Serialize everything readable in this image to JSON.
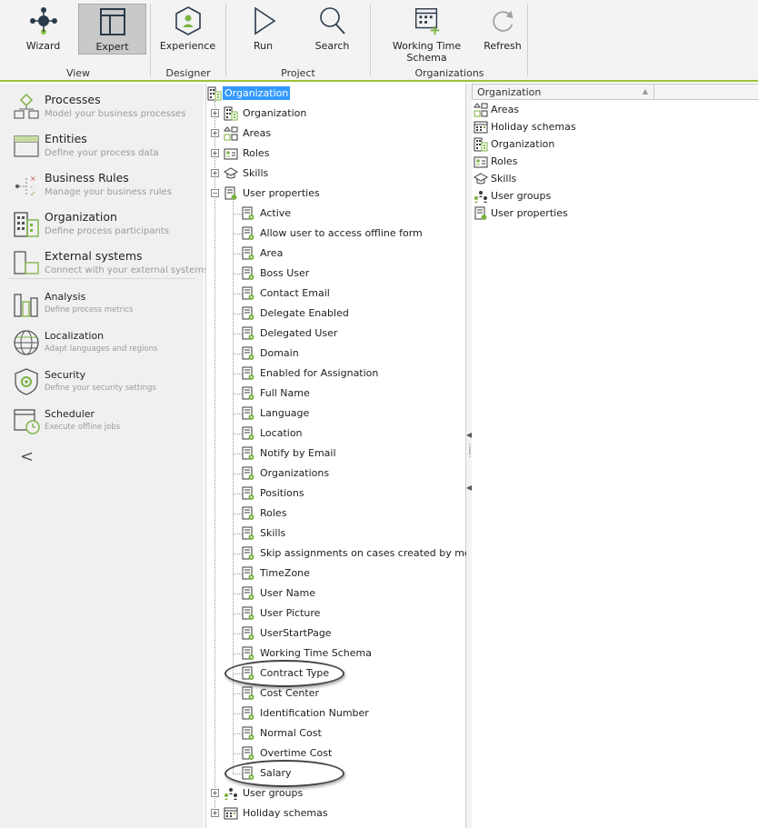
{
  "ribbon": {
    "groups": [
      {
        "label": "View"
      },
      {
        "label": "Designer"
      },
      {
        "label": "Project"
      },
      {
        "label": "Organizations"
      }
    ],
    "buttons": {
      "wizard": "Wizard",
      "expert": "Expert",
      "experience": "Experience",
      "run": "Run",
      "search": "Search",
      "working_time_schema": "Working Time Schema",
      "refresh": "Refresh"
    }
  },
  "leftnav": {
    "items": [
      {
        "title": "Processes",
        "sub": "Model your business processes"
      },
      {
        "title": "Entities",
        "sub": "Define your process data"
      },
      {
        "title": "Business Rules",
        "sub": "Manage your business rules"
      },
      {
        "title": "Organization",
        "sub": "Define process participants"
      },
      {
        "title": "External systems",
        "sub": "Connect with your external systems"
      },
      {
        "title": "Analysis",
        "sub": "Define process metrics"
      },
      {
        "title": "Localization",
        "sub": "Adapt languages and regions"
      },
      {
        "title": "Security",
        "sub": "Define your security settings"
      },
      {
        "title": "Scheduler",
        "sub": "Execute offline jobs"
      }
    ],
    "collapse_glyph": "<"
  },
  "tree": {
    "root": "Organization",
    "top_nodes": [
      "Organization",
      "Areas",
      "Roles",
      "Skills",
      "User properties"
    ],
    "user_properties": [
      "Active",
      "Allow user to access offline form",
      "Area",
      "Boss User",
      "Contact Email",
      "Delegate Enabled",
      "Delegated User",
      "Domain",
      "Enabled for Assignation",
      "Full Name",
      "Language",
      "Location",
      "Notify by Email",
      "Organizations",
      "Positions",
      "Roles",
      "Skills",
      "Skip assignments on cases created by me",
      "TimeZone",
      "User Name",
      "User Picture",
      "UserStartPage",
      "Working Time Schema",
      "Contract Type",
      "Cost Center",
      "Identification Number",
      "Normal Cost",
      "Overtime Cost",
      "Salary"
    ],
    "bottom_nodes": [
      "User groups",
      "Holiday schemas"
    ]
  },
  "rightlist": {
    "column_header": "Organization",
    "items": [
      {
        "label": "Areas",
        "icon": "areas-icon"
      },
      {
        "label": "Holiday schemas",
        "icon": "calendar-icon"
      },
      {
        "label": "Organization",
        "icon": "building-icon"
      },
      {
        "label": "Roles",
        "icon": "roles-icon"
      },
      {
        "label": "Skills",
        "icon": "graduation-cap-icon"
      },
      {
        "label": "User groups",
        "icon": "user-groups-icon"
      },
      {
        "label": "User properties",
        "icon": "user-properties-icon"
      }
    ]
  },
  "colors": {
    "accent_green": "#9ec33a",
    "selection_blue": "#3399ff",
    "icon_green": "#7cb342"
  }
}
